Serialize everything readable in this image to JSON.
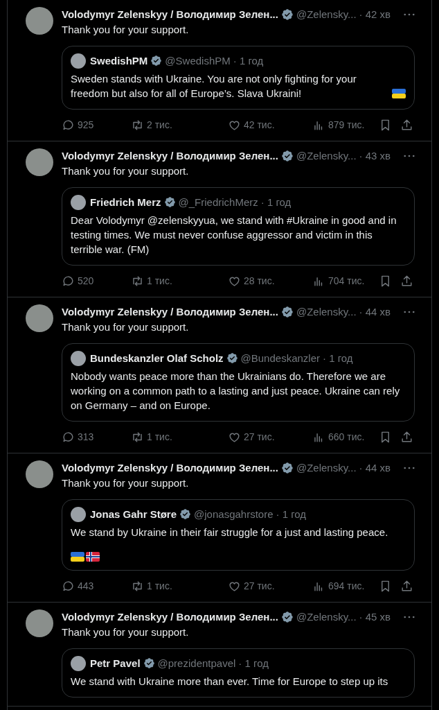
{
  "posts": [
    {
      "author": "Volodymyr Zelenskyy / Володимир Зелен...",
      "handle": "@Zelensky...",
      "time": "· 42 хв",
      "verified": true,
      "text": "Thank you for your support.",
      "quote": {
        "author": "SwedishPM",
        "handle": "@SwedishPM",
        "time": "· 1 год",
        "verified": true,
        "text": "Sweden stands with Ukraine. You are not only fighting for your freedom but also for all of Europe’s. Slava Ukraini!",
        "inline_flags": [
          {
            "kind": "ukraine"
          }
        ]
      },
      "replies": "925",
      "reposts": "2 тис.",
      "likes": "42 тис.",
      "views": "879 тис."
    },
    {
      "author": "Volodymyr Zelenskyy / Володимир Зелен...",
      "handle": "@Zelensky...",
      "time": "· 43 хв",
      "verified": true,
      "text": "Thank you for your support.",
      "quote": {
        "author": "Friedrich Merz",
        "handle": "@_FriedrichMerz",
        "time": "· 1 год",
        "verified": true,
        "text": "Dear Volodymyr @zelenskyyua, we stand with #Ukraine in good and in testing times. We must never confuse aggressor and victim in this terrible war. (FM)"
      },
      "replies": "520",
      "reposts": "1 тис.",
      "likes": "28 тис.",
      "views": "704 тис."
    },
    {
      "author": "Volodymyr Zelenskyy / Володимир Зелен...",
      "handle": "@Zelensky...",
      "time": "· 44 хв",
      "verified": true,
      "text": "Thank you for your support.",
      "quote": {
        "author": "Bundeskanzler Olaf Scholz",
        "handle": "@Bundeskanzler",
        "time": "· 1 год",
        "verified": true,
        "text": "Nobody wants peace more than the Ukrainians do. Therefore we are working on a common path to a lasting and just peace. Ukraine can rely on Germany – and on Europe."
      },
      "replies": "313",
      "reposts": "1 тис.",
      "likes": "27 тис.",
      "views": "660 тис."
    },
    {
      "author": "Volodymyr Zelenskyy / Володимир Зелен...",
      "handle": "@Zelensky...",
      "time": "· 44 хв",
      "verified": true,
      "text": "Thank you for your support.",
      "quote": {
        "author": "Jonas Gahr Støre",
        "handle": "@jonasgahrstore",
        "time": "· 1 год",
        "verified": true,
        "text": "We stand by Ukraine in their fair struggle for a just and lasting peace.",
        "flag_row": [
          {
            "kind": "ukraine"
          },
          {
            "kind": "norway"
          }
        ]
      },
      "replies": "443",
      "reposts": "1 тис.",
      "likes": "27 тис.",
      "views": "694 тис."
    },
    {
      "author": "Volodymyr Zelenskyy / Володимир Зелен...",
      "handle": "@Zelensky...",
      "time": "· 45 хв",
      "verified": true,
      "text": "Thank you for your support.",
      "quote": {
        "author": "Petr Pavel",
        "handle": "@prezidentpavel",
        "time": "· 1 год",
        "verified": true,
        "text": "We stand with Ukraine more than ever. Time for Europe to step up its"
      }
    }
  ]
}
